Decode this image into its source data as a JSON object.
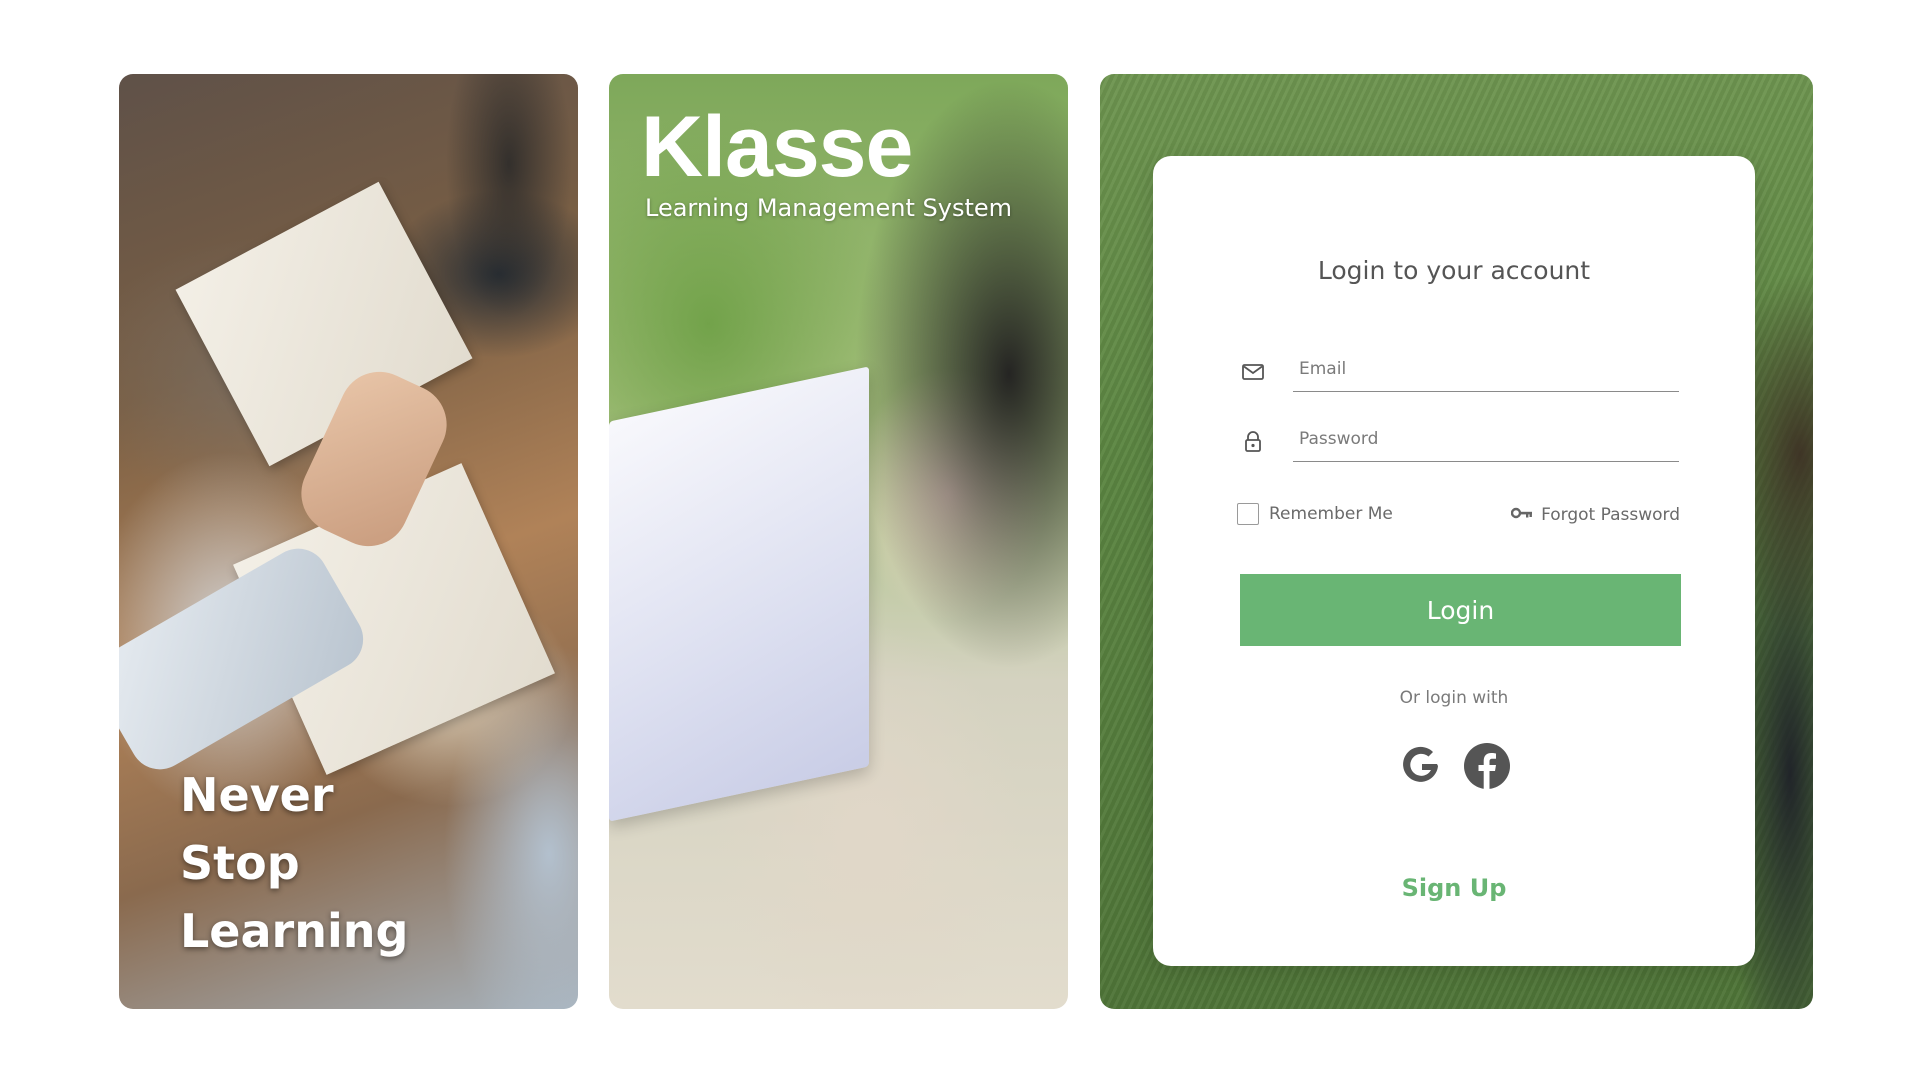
{
  "brand": {
    "name": "Klasse",
    "subtitle": "Learning Management System"
  },
  "tagline": {
    "line1": "Never",
    "line2": "Stop",
    "line3": "Learning"
  },
  "login": {
    "title": "Login to your account",
    "email_placeholder": "Email",
    "password_placeholder": "Password",
    "remember_label": "Remember Me",
    "forgot_label": "Forgot Password",
    "submit_label": "Login",
    "alt_label": "Or login with",
    "signup_label": "Sign Up",
    "social": [
      "google-icon",
      "facebook-icon"
    ]
  },
  "colors": {
    "accent": "#69b574",
    "text_muted": "#6a6a6a",
    "icon": "#555555"
  }
}
